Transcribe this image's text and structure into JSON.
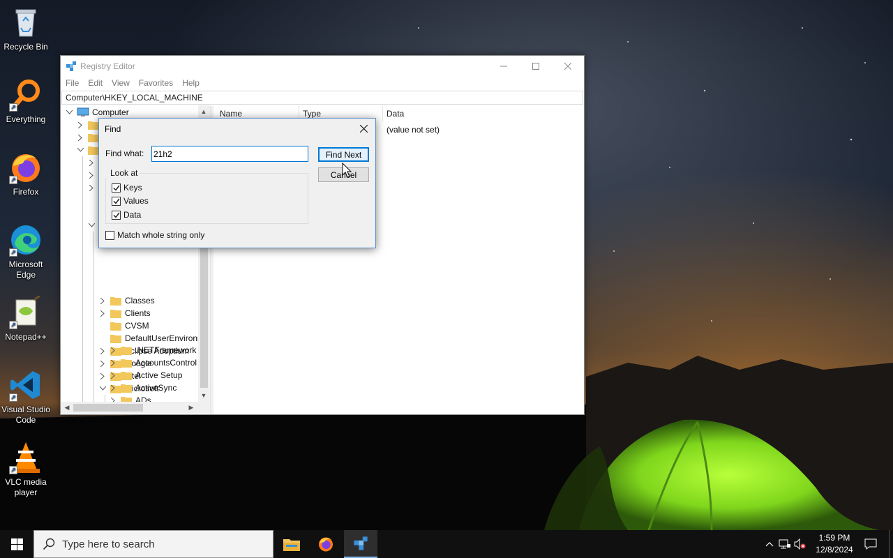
{
  "desktop": {
    "icons": [
      {
        "label": "Recycle Bin",
        "icon": "recycle-bin-icon"
      },
      {
        "label": "Everything",
        "icon": "everything-search-icon"
      },
      {
        "label": "Firefox",
        "icon": "firefox-icon"
      },
      {
        "label": "Microsoft Edge",
        "icon": "edge-icon"
      },
      {
        "label": "Notepad++",
        "icon": "notepadpp-icon"
      },
      {
        "label": "Visual Studio Code",
        "icon": "vscode-icon"
      },
      {
        "label": "VLC media player",
        "icon": "vlc-icon"
      }
    ]
  },
  "regedit": {
    "title": "Registry Editor",
    "menu": [
      "File",
      "Edit",
      "View",
      "Favorites",
      "Help"
    ],
    "address": "Computer\\HKEY_LOCAL_MACHINE",
    "columns": {
      "name": "Name",
      "type": "Type",
      "data": "Data"
    },
    "first_value_data": "(value not set)",
    "tree": {
      "root": "Computer",
      "items": [
        "Classes",
        "Clients",
        "CVSM",
        "DefaultUserEnvironn",
        "Eclipse Adoptium",
        "Google",
        "Intel",
        "Microsoft"
      ],
      "microsoft_children": [
        ".NETFramework",
        "AccountsControl",
        "Active Setup",
        "ActiveSync",
        "ADs"
      ]
    }
  },
  "find_dialog": {
    "title": "Find",
    "find_what_label": "Find what:",
    "find_what_value": "21h2",
    "find_next_label": "Find Next",
    "cancel_label": "Cancel",
    "look_at_label": "Look at",
    "options": [
      {
        "label": "Keys",
        "checked": true
      },
      {
        "label": "Values",
        "checked": true
      },
      {
        "label": "Data",
        "checked": true
      }
    ],
    "match_whole": {
      "label": "Match whole string only",
      "checked": false
    }
  },
  "taskbar": {
    "search_placeholder": "Type here to search",
    "time": "1:59 PM",
    "date": "12/8/2024",
    "apps": [
      "file-explorer-icon",
      "firefox-icon",
      "regedit-icon"
    ]
  }
}
